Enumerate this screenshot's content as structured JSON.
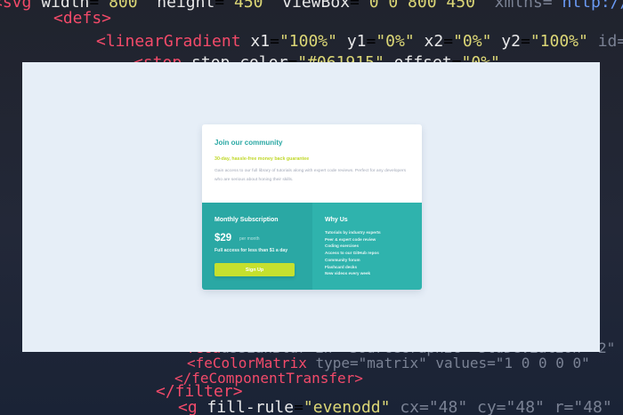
{
  "card": {
    "title": "Join our community",
    "guarantee": "30-day, hassle-free money back guarantee",
    "description": "Gain access to our full library of tutorials along with expert code reviews. Perfect for any developers who are serious about honing their skills."
  },
  "subscription": {
    "title": "Monthly Subscription",
    "price": "$29",
    "period": "per month",
    "access_text": "Full access for less than $1 a day",
    "signup_label": "Sign Up"
  },
  "why_us": {
    "title": "Why Us",
    "items": [
      "Tutorials by industry experts",
      "Peer & expert code review",
      "Coding exercises",
      "Access to our GitHub repos",
      "Community forum",
      "Flashcard decks",
      "New videos every week"
    ]
  },
  "colors": {
    "panel_bg": "#e6eef7",
    "accent_teal": "#2aa8a4",
    "accent_teal_light": "#2fb3ad",
    "accent_lime": "#c5e02e"
  }
}
